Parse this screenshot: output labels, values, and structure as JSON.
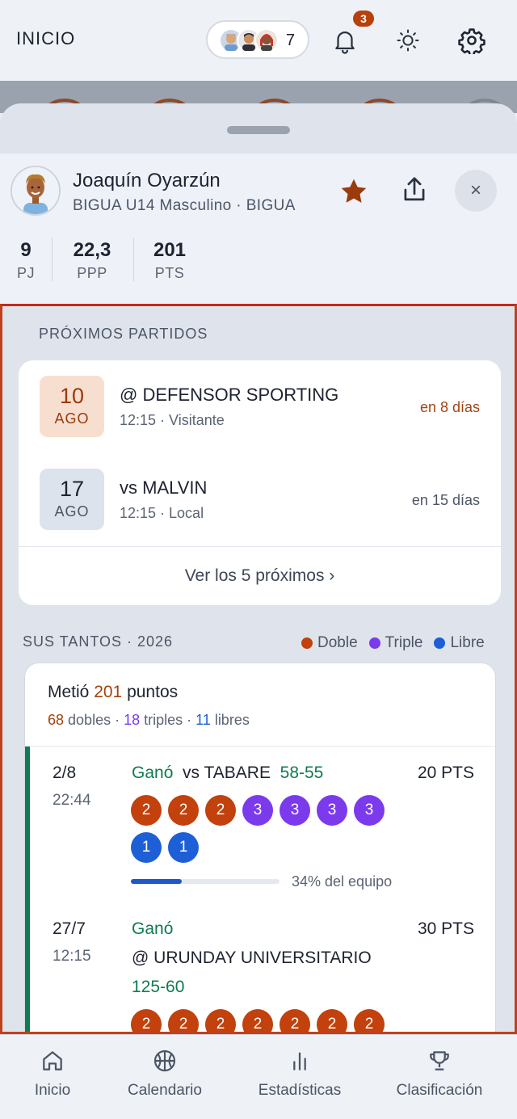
{
  "header": {
    "title": "INICIO",
    "followers_count": "7",
    "notifications_badge": "3"
  },
  "profile": {
    "name": "Joaquín Oyarzún",
    "team": "BIGUA U14 Masculino · BIGUA",
    "stats": [
      {
        "value": "9",
        "label": "PJ"
      },
      {
        "value": "22,3",
        "label": "PPP"
      },
      {
        "value": "201",
        "label": "PTS"
      }
    ]
  },
  "upcoming": {
    "title": "PRÓXIMOS PARTIDOS",
    "matches": [
      {
        "day": "10",
        "month": "AGO",
        "name": "@ DEFENSOR SPORTING",
        "sub": "12:15 · Visitante",
        "when": "en 8 días"
      },
      {
        "day": "17",
        "month": "AGO",
        "name": "vs MALVIN",
        "sub": "12:15 · Local",
        "when": "en 15 días"
      }
    ],
    "see_more": "Ver los 5 próximos ›"
  },
  "scoring": {
    "title": "SUS TANTOS · 2026",
    "legend": [
      "Doble",
      "Triple",
      "Libre"
    ],
    "head_prefix": "Metió ",
    "head_total": "201",
    "head_suffix": " puntos",
    "doubles": "68",
    "doubles_label": " dobles · ",
    "triples": "18",
    "triples_label": " triples · ",
    "frees": "11",
    "frees_label": " libres",
    "games": [
      {
        "date": "2/8",
        "time": "22:44",
        "result": "Ganó",
        "opponent": "vs TABARE",
        "score": "58-55",
        "points": "20 PTS",
        "chips": [
          "2",
          "2",
          "2",
          "3",
          "3",
          "3",
          "3",
          "1",
          "1"
        ],
        "team_share": 0.34,
        "team_share_label": "34% del equipo"
      },
      {
        "date": "27/7",
        "time": "12:15",
        "result": "Ganó",
        "opponent": "@ URUNDAY UNIVERSITARIO",
        "score": "125-60",
        "points": "30 PTS",
        "chips": [
          "2",
          "2",
          "2",
          "2",
          "2",
          "2",
          "2"
        ]
      }
    ]
  },
  "nav": [
    "Inicio",
    "Calendario",
    "Estadísticas",
    "Clasificación"
  ],
  "colors": {
    "doble": "#c2410c",
    "triple": "#7c3aed",
    "libre": "#1d5fd6",
    "win": "#0f7b4f",
    "accent": "#b8400a"
  }
}
